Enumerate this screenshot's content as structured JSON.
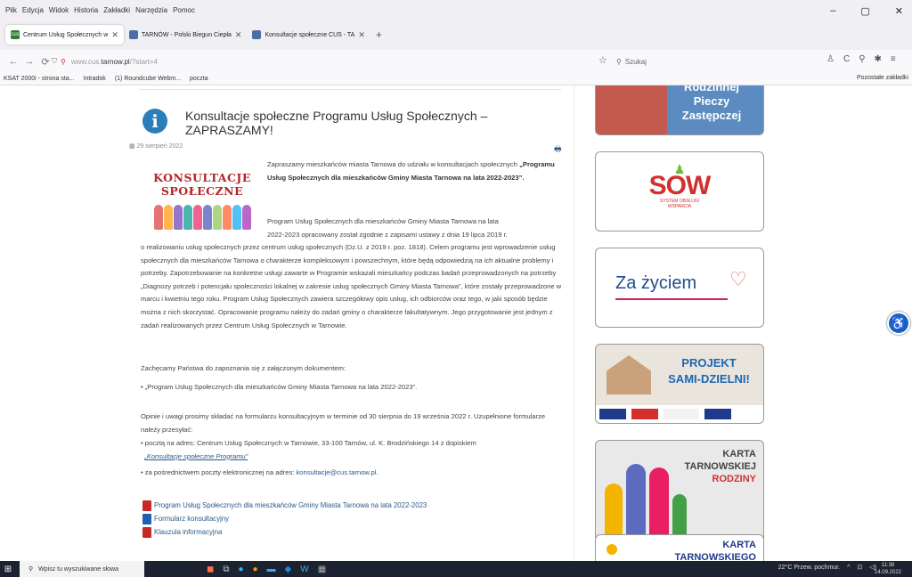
{
  "menu": [
    "Plik",
    "Edycja",
    "Widok",
    "Historia",
    "Zakładki",
    "Narzędzia",
    "Pomoc"
  ],
  "window_controls": [
    "–",
    "▢",
    "✕"
  ],
  "tabs": [
    {
      "label": "Centrum Usług Społecznych w ",
      "favicon": "cus"
    },
    {
      "label": "TARNÓW - Polski Biegun Ciepła",
      "favicon": ""
    },
    {
      "label": "Konsultacje społeczne CUS - TA",
      "favicon": ""
    }
  ],
  "newtab": "+",
  "nav": {
    "url_host": "www.cus.",
    "url_domain": "tarnow.pl",
    "url_path": "/?start=4",
    "search_placeholder": "Szukaj"
  },
  "bookmarks": [
    "KSAT 2000i - strona sta...",
    "Intradok",
    "(1) Roundcube Webm...",
    "poczta"
  ],
  "bookmarks_other": "Pozostałe zakładki",
  "article": {
    "title": "Konsultacje społeczne Programu Usług Społecznych – ZAPRASZAMY!",
    "date": "29 sierpień 2022",
    "hero_line1": "KONSULTACJE",
    "hero_line2": "SPOŁECZNE",
    "intro": "Zapraszamy mieszkańców miasta Tarnowa do udziału w konsultacjach społecznych",
    "intro_bold": "„Programu Usług Społecznych dla mieszkańców Gminy Miasta Tarnowa na lata 2022-2023”.",
    "p1_a": "Program Usług Społecznych dla mieszkańców Gminy Miasta Tarnowa na lata",
    "p1_b": "2022-2023 opracowany został zgodnie z zapisami ustawy z dnia 19 lipca 2019 r.",
    "p1_rest": "o realizowaniu usług społecznych przez centrum usług społecznych (Dz.U. z 2019 r. poz. 1818). Celem programu jest wprowadzenie usług społecznych dla mieszkańców Tarnowa o charakterze kompleksowym i powszechnym, które będą odpowiedzią na ich aktualne problemy i potrzeby. Zapotrzebowanie na konkretne usługi zawarte w Programie wskazali mieszkańcy podczas badań przeprowadzonych na potrzeby „Diagnozy potrzeb i potencjału społeczności lokalnej w zakresie usług społecznych Gminy Miasta Tarnowa”, które zostały przeprowadzone w marcu i kwietniu tego roku. Program Usług Społecznych zawiera szczegółowy opis usług, ich odbiorców oraz tego, w jaki sposób będzie można z nich skorzystać. Opracowanie programu należy do zadań gminy o charakterze fakultatywnym. Jego przygotowanie jest jednym z zadań realizowanych przez Centrum Usług Społecznych w Tarnowie.",
    "p2": "Zachęcamy Państwa do zapoznania się z załączonym dokumentem:",
    "p2_item": "„Program Usług Społecznych dla mieszkańców Gminy Miasta Tarnowa na lata 2022-2023”.",
    "p3": "Opinie i uwagi prosimy składać na formularzu konsultacyjnym w terminie od 30 sierpnia do 19 września 2022 r. Uzupełnione formularze należy przesyłać:",
    "p3_item1": "pocztą na adres: Centrum Usług Społecznych w Tarnowie, 33-100 Tarnów, ul. K. Brodzińskiego 14 z dopiskiem",
    "p3_item1_link": "„Konsultacje społeczne Programu”",
    "p3_item2": "za pośrednictwem poczty elektronicznej na adres:",
    "p3_item2_email": "konsultacje@cus.tarnow.pl",
    "p3_item2_end": ".",
    "files": [
      {
        "label": "Program Usług Społecznych dla mieszkańców Gminy Miasta Tarnowa na lata 2022-2023",
        "type": "pdf-icon"
      },
      {
        "label": "Formularz konsultacyjny",
        "type": "doc-icon"
      },
      {
        "label": "Klauzula informacyjna",
        "type": "pdf-icon"
      }
    ]
  },
  "sidebar": {
    "banner1_lines": [
      "Rodzinnej",
      "Pieczy",
      "Zastępczej"
    ],
    "sow_main": "SOW",
    "sow_sub1": "SYSTEM OBSŁUGI",
    "sow_sub2": "WSPARCIA",
    "za_zyciem": "Za życiem",
    "projekt_line1": "PROJEKT",
    "projekt_line2": "SAMI-DZIELNI!",
    "karta_line1": "KARTA",
    "karta_line2": "TARNOWSKIEJ",
    "karta_line3": "RODZINY",
    "karta2_line1": "KARTA",
    "karta2_line2": "TARNOWSKIEGO"
  },
  "taskbar": {
    "search": "Wpisz tu wyszukiwane słowa",
    "weather": "22°C  Przew. pochmur.",
    "time": "11:38",
    "date": "14.09.2022"
  }
}
